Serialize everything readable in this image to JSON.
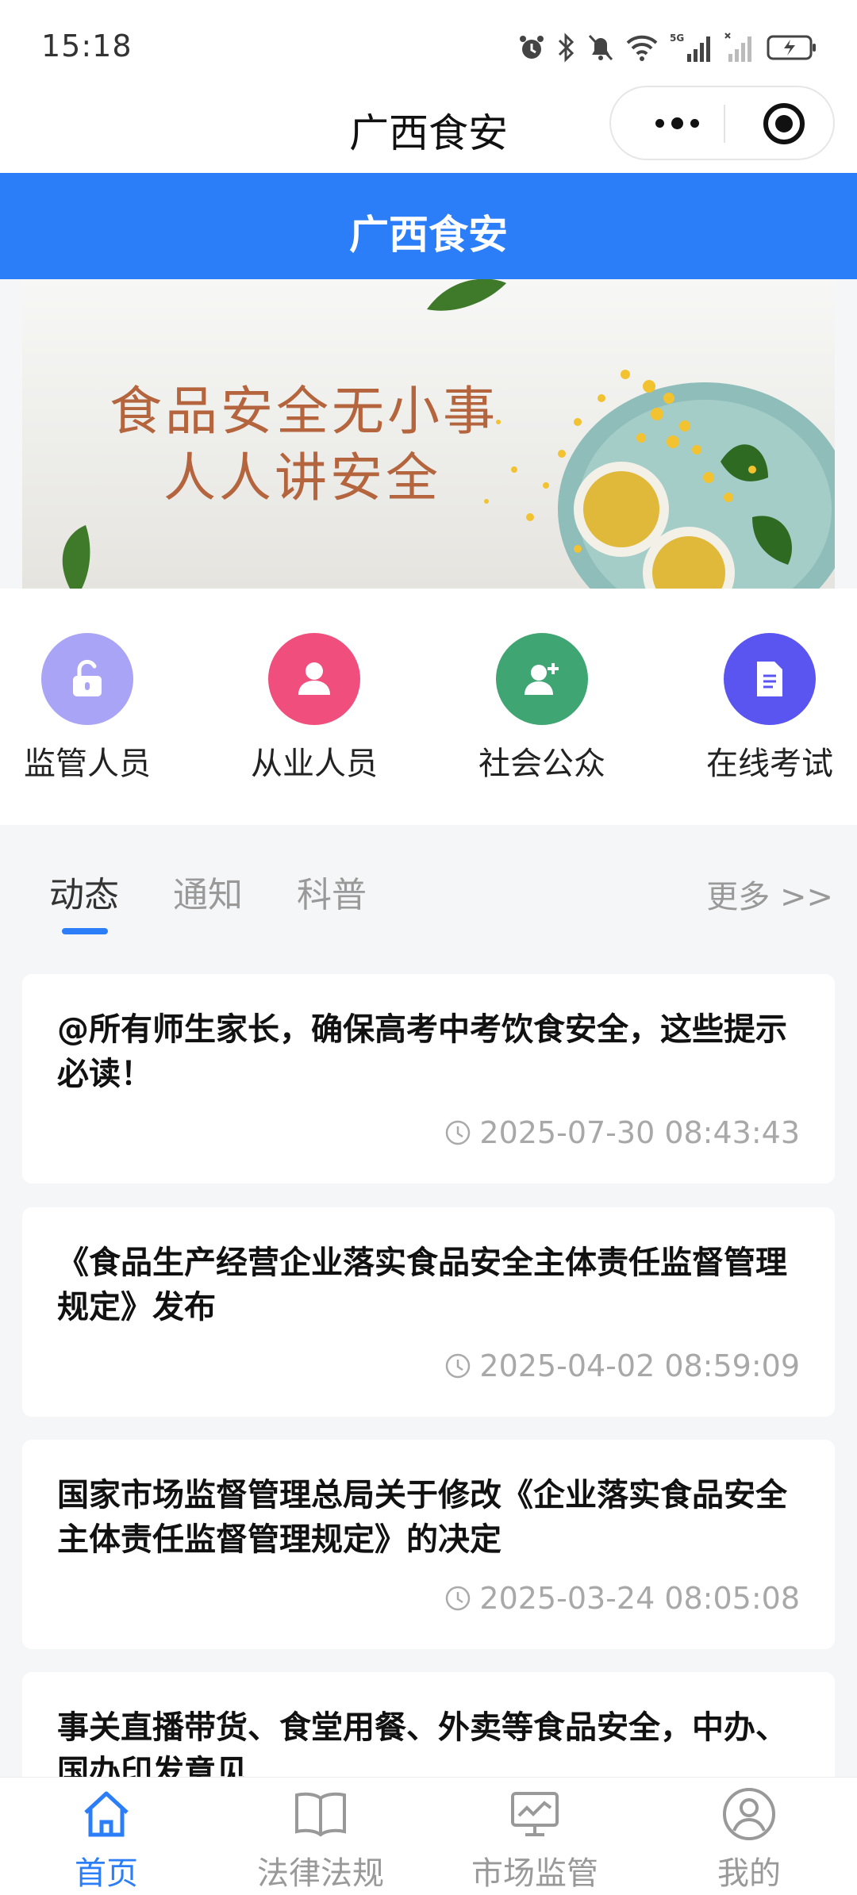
{
  "status_bar": {
    "time": "15:18",
    "network": "5G"
  },
  "mini_program": {
    "title": "广西食安"
  },
  "header": {
    "title": "广西食安"
  },
  "banner": {
    "line1": "食品安全无小事",
    "line2": "人人讲安全"
  },
  "quick_entries": [
    {
      "label": "监管人员",
      "icon": "unlock-icon",
      "color": "#a9a4f5"
    },
    {
      "label": "从业人员",
      "icon": "person-icon",
      "color": "#f04e7c"
    },
    {
      "label": "社会公众",
      "icon": "person-add-icon",
      "color": "#3fa573"
    },
    {
      "label": "在线考试",
      "icon": "document-icon",
      "color": "#5a55f0"
    }
  ],
  "tabs": {
    "items": [
      "动态",
      "通知",
      "科普"
    ],
    "active": "动态",
    "more": "更多 >>"
  },
  "news": [
    {
      "title": "@所有师生家长，确保高考中考饮食安全，这些提示必读！",
      "time": "2025-07-30 08:43:43"
    },
    {
      "title": "《食品生产经营企业落实食品安全主体责任监督管理规定》发布",
      "time": "2025-04-02 08:59:09"
    },
    {
      "title": "国家市场监督管理总局关于修改《企业落实食品安全主体责任监督管理规定》的决定",
      "time": "2025-03-24 08:05:08"
    },
    {
      "title": "事关直播带货、食堂用餐、外卖等食品安全，中办、国办印发意见",
      "time": ""
    }
  ],
  "tabbar": {
    "items": [
      "首页",
      "法律法规",
      "市场监管",
      "我的"
    ],
    "active": "首页"
  },
  "colors": {
    "brand_blue": "#2c7ef8"
  }
}
